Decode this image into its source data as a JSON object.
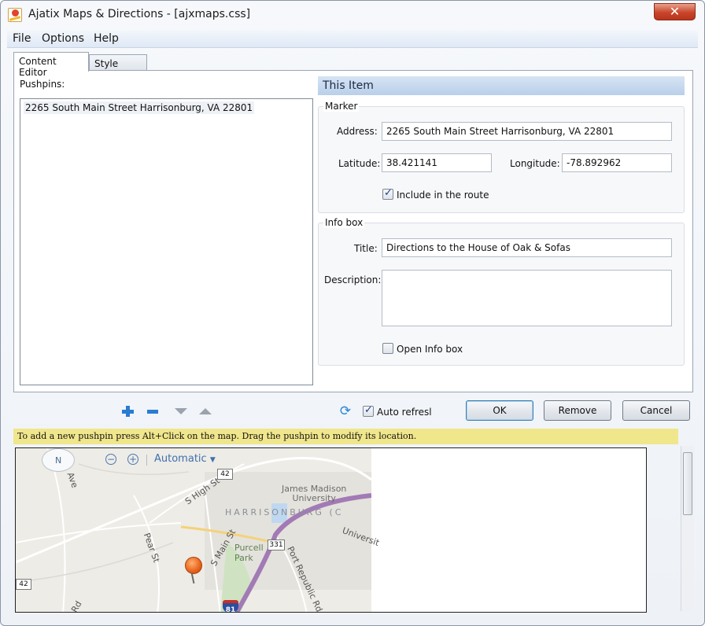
{
  "window": {
    "title": "Ajatix Maps & Directions - [ajxmaps.css]"
  },
  "menu": [
    "File",
    "Options",
    "Help"
  ],
  "tabs": [
    "Content Editor",
    "Style Editor"
  ],
  "pushpins": {
    "label": "Pushpins:",
    "items": [
      "2265 South Main Street Harrisonburg, VA 22801"
    ]
  },
  "item": {
    "header": "This Item",
    "marker": {
      "group": "Marker",
      "address_label": "Address:",
      "address": "2265 South Main Street Harrisonburg, VA 22801",
      "latitude_label": "Latitude:",
      "latitude": "38.421141",
      "longitude_label": "Longitude:",
      "longitude": "-78.892962",
      "include_route_label": "Include in the route",
      "include_route": true
    },
    "infobox": {
      "group": "Info box",
      "title_label": "Title:",
      "title": "Directions to the House of Oak & Sofas",
      "description_label": "Description:",
      "description": "",
      "open_label": "Open Info box",
      "open": false
    }
  },
  "toolbar": {
    "auto_refresh_label": "Auto refresl",
    "auto_refresh": true
  },
  "buttons": {
    "ok": "OK",
    "remove": "Remove",
    "cancel": "Cancel"
  },
  "hint": "To add a new pushpin press Alt+Click on the map. Drag the pushpin to modify its location.",
  "map": {
    "compass": "N",
    "mode": "Automatic",
    "labels": {
      "harrisonburg": "HARRISONBURG (C",
      "jmu": "James Madison\nUniversity",
      "purcell": "Purcell\nPark",
      "s_high": "S High St",
      "s_main": "S Main St",
      "pear": "Pear St",
      "port_republic": "Port Republic Rd",
      "university": "Universit",
      "ave": "Ave",
      "rd": "Rd",
      "shield_42_top": "42",
      "shield_42_left": "42",
      "shield_331": "331",
      "shield_81": "81"
    }
  }
}
